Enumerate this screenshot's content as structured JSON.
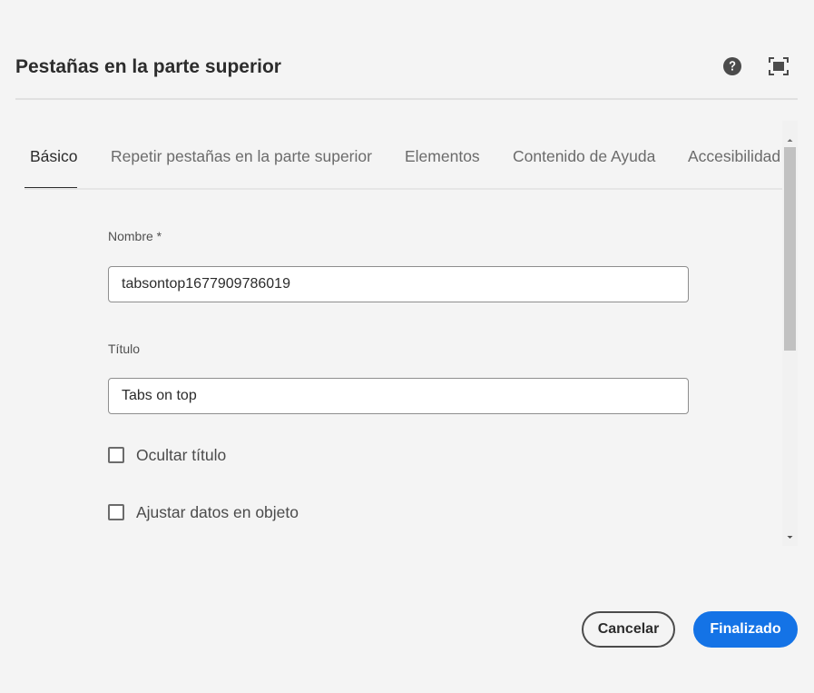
{
  "dialog": {
    "title": "Pestañas en la parte superior",
    "help_icon": "help-circle-icon",
    "fullscreen_icon": "fullscreen-icon"
  },
  "tabs": [
    {
      "label": "Básico",
      "active": true
    },
    {
      "label": "Repetir pestañas en la parte superior",
      "active": false
    },
    {
      "label": "Elementos",
      "active": false
    },
    {
      "label": "Contenido de Ayuda",
      "active": false
    },
    {
      "label": "Accesibilidad",
      "active": false
    }
  ],
  "form": {
    "name": {
      "label": "Nombre *",
      "value": "tabsontop1677909786019"
    },
    "title": {
      "label": "Título",
      "value": "Tabs on top"
    },
    "hide_title": {
      "label": "Ocultar título",
      "checked": false
    },
    "wrap_data": {
      "label": "Ajustar datos en objeto",
      "checked": false
    }
  },
  "footer": {
    "cancel_label": "Cancelar",
    "done_label": "Finalizado"
  },
  "colors": {
    "accent": "#1473e6",
    "background": "#f4f4f4"
  }
}
